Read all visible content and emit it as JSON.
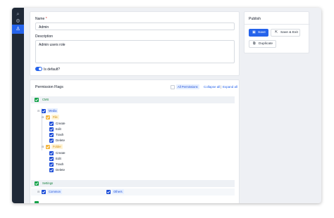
{
  "sidebar": {
    "icons": [
      "search-icon",
      "settings-icon",
      "users-icon"
    ]
  },
  "form": {
    "name_label": "Name",
    "name_required": "*",
    "name_value": "Admin",
    "description_label": "Description",
    "description_value": "Admin users role",
    "default_label": "Is default?",
    "default_on": true
  },
  "permissions": {
    "title": "Permission Flags",
    "all_permissions": "All Permissions",
    "collapse_all": "Collapse all",
    "separator": "|",
    "expand_all": "Expand all",
    "cms": "CMS",
    "media": "Media",
    "file": "File",
    "file_actions": [
      "Create",
      "Edit",
      "Trash",
      "Delete"
    ],
    "folder": "Folder",
    "folder_actions": [
      "Create",
      "Edit",
      "Trash",
      "Delete"
    ],
    "settings": "Settings",
    "common": "Common",
    "others": "Others"
  },
  "publish": {
    "title": "Publish",
    "save": "Save",
    "save_exit": "Save & Exit",
    "duplicate": "Duplicate"
  },
  "colors": {
    "primary": "#2563eb",
    "sidebar": "#1f2937",
    "green": "#16a34a",
    "yellow": "#f4b63f"
  }
}
